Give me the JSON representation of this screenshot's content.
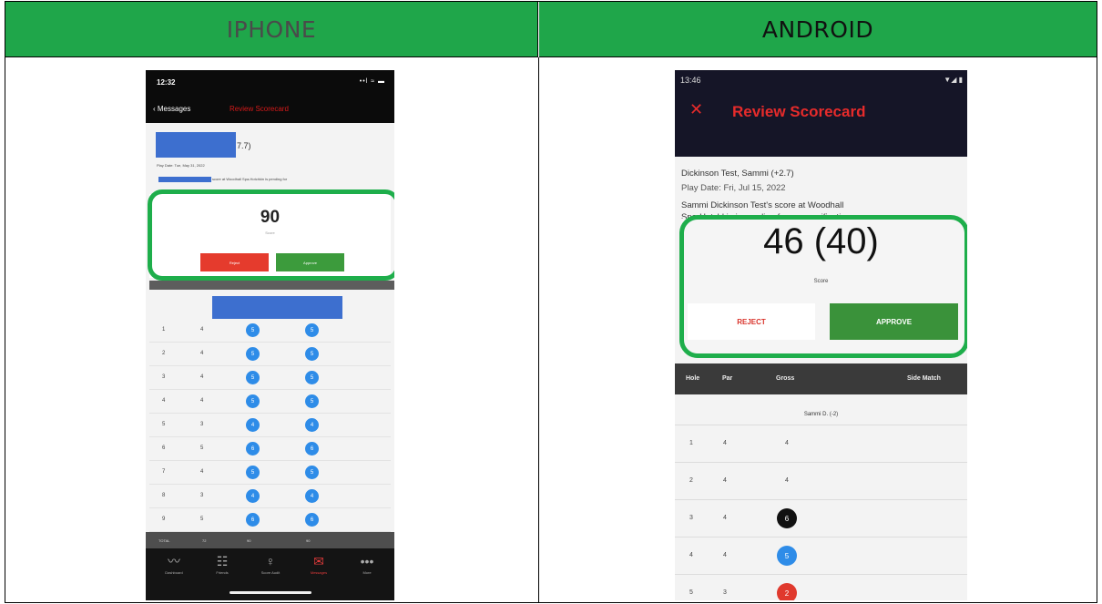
{
  "headers": {
    "left": "IPHONE",
    "right": "ANDROID"
  },
  "iphone": {
    "status_time": "12:32",
    "status_icons": "••l ≈ ▬",
    "back_label": "Messages",
    "nav_title": "Review Scorecard",
    "handicap_suffix": "7.7)",
    "play_date": "Play Date: Tue, May 31, 2022",
    "pending_text": "score at Woodhall Spa-Hotchkin is pending for",
    "score": "90",
    "score_label": "Score",
    "reject_label": "Reject",
    "approve_label": "Approve",
    "holes": [
      {
        "hole": "1",
        "par": "4",
        "gross": "5",
        "side": "5"
      },
      {
        "hole": "2",
        "par": "4",
        "gross": "5",
        "side": "5"
      },
      {
        "hole": "3",
        "par": "4",
        "gross": "5",
        "side": "5"
      },
      {
        "hole": "4",
        "par": "4",
        "gross": "5",
        "side": "5"
      },
      {
        "hole": "5",
        "par": "3",
        "gross": "4",
        "side": "4"
      },
      {
        "hole": "6",
        "par": "5",
        "gross": "6",
        "side": "6"
      },
      {
        "hole": "7",
        "par": "4",
        "gross": "5",
        "side": "5"
      },
      {
        "hole": "8",
        "par": "3",
        "gross": "4",
        "side": "4"
      },
      {
        "hole": "9",
        "par": "5",
        "gross": "6",
        "side": "6"
      }
    ],
    "total_row": {
      "label": "TOTAL",
      "par": "72",
      "gross": "90",
      "side": "90"
    },
    "tabs": [
      {
        "label": "Dashboard",
        "icon": "chart-line-icon",
        "glyph": "〰"
      },
      {
        "label": "Friends",
        "icon": "friends-icon",
        "glyph": "☷"
      },
      {
        "label": "Score Audit",
        "icon": "lightbulb-icon",
        "glyph": "♀"
      },
      {
        "label": "Messages",
        "icon": "mail-icon",
        "glyph": "✉"
      },
      {
        "label": "More",
        "icon": "more-icon",
        "glyph": "•••"
      }
    ]
  },
  "android": {
    "status_time": "13:46",
    "status_icons": "▼◢ ▮",
    "nav_title": "Review Scorecard",
    "player_line": "Dickinson Test, Sammi (+2.7)",
    "play_date": "Play Date: Fri, Jul 15, 2022",
    "pending_line1": "Sammi Dickinson Test's score at Woodhall",
    "pending_line2": "Spa-Hotchkin is pending for your verification.",
    "score": "46 (40)",
    "score_label": "Score",
    "reject_label": "REJECT",
    "approve_label": "APPROVE",
    "columns": {
      "hole": "Hole",
      "par": "Par",
      "gross": "Gross",
      "side": "Side Match"
    },
    "player_short": "Sammi D. (-2)",
    "holes": [
      {
        "hole": "1",
        "par": "4",
        "gross": "4",
        "style": "plain"
      },
      {
        "hole": "2",
        "par": "4",
        "gross": "4",
        "style": "plain"
      },
      {
        "hole": "3",
        "par": "4",
        "gross": "6",
        "style": "black"
      },
      {
        "hole": "4",
        "par": "4",
        "gross": "5",
        "style": "blue"
      },
      {
        "hole": "5",
        "par": "3",
        "gross": "2",
        "style": "red"
      }
    ]
  },
  "colors": {
    "header_green": "#1fa64a",
    "highlight_green": "#1eae4b",
    "reject_red": "#e53b2d",
    "approve_green": "#3c9b3c",
    "circle_blue": "#2e8ce8"
  }
}
